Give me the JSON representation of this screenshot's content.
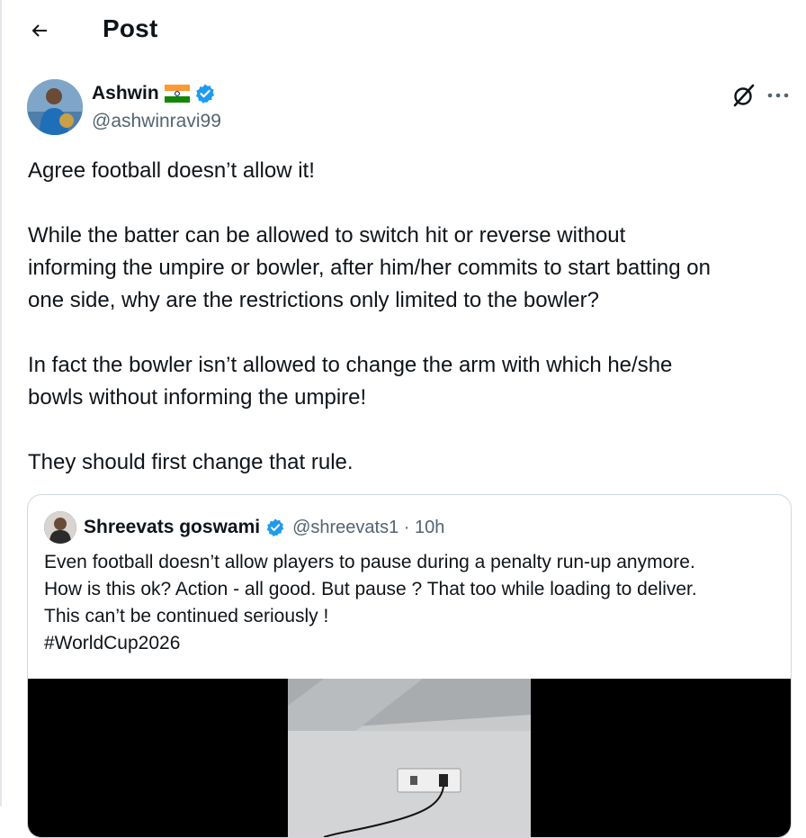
{
  "header": {
    "title": "Post"
  },
  "author": {
    "name": "Ashwin",
    "handle": "@ashwinravi99"
  },
  "post": {
    "paragraphs": [
      "Agree football doesn’t allow it!",
      "While the batter can be allowed to switch hit or reverse without",
      "informing the umpire or bowler, after him/her commits to start batting on",
      "one side, why are the restrictions only limited to the bowler?",
      "In fact the bowler isn’t allowed to change the arm with which he/she",
      "bowls without informing the umpire!",
      "They should first change that rule."
    ]
  },
  "quote": {
    "name": "Shreevats goswami",
    "handle_time": "@shreevats1 · 10h",
    "lines": [
      "Even football doesn’t allow players to pause during a penalty run-up anymore.",
      "How is this ok? Action - all good. But pause ? That too while loading to deliver.",
      "This can’t be continued seriously !",
      "#WorldCup2026"
    ]
  },
  "colors": {
    "text": "#0f1419",
    "secondary": "#536471",
    "verified": "#1d9bf0",
    "border": "#cfd9de"
  },
  "icons": {
    "back": "arrow-left-icon",
    "verified": "verified-badge-icon",
    "grok": "grok-icon",
    "more": "more-dots-icon",
    "flag": "india-flag-icon"
  }
}
